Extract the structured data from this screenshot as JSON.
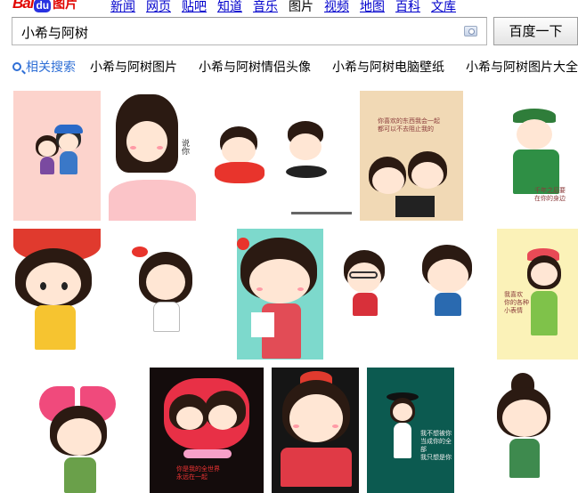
{
  "logo": {
    "bai": "Bai",
    "du": "du",
    "tupian": "图片"
  },
  "nav": [
    "新闻",
    "网页",
    "贴吧",
    "知道",
    "音乐",
    "图片",
    "视频",
    "地图",
    "百科",
    "文库"
  ],
  "search": {
    "query": "小希与阿树",
    "button": "百度一下"
  },
  "related": {
    "heading": "相关搜索",
    "items": [
      "小希与阿树图片",
      "小希与阿树情侣头像",
      "小希与阿树电脑壁纸",
      "小希与阿树图片大全"
    ]
  },
  "colors": {
    "brand_red": "#e10602",
    "brand_blue": "#2932e1",
    "link_blue": "#0000cc",
    "related_blue": "#2f6fd6"
  },
  "results": [
    {
      "label": "cartoon couple pink background"
    },
    {
      "label": "long hair girl with speech text"
    },
    {
      "label": "girl with red bow and boy with mustache"
    },
    {
      "label": "couple with clapperboard and chinese text"
    },
    {
      "label": "boy in green army cap"
    },
    {
      "label": "girl in red hat and yellow shirt"
    },
    {
      "label": "girl with red bow walking"
    },
    {
      "label": "girl in red overalls on mint background"
    },
    {
      "label": "couple glasses girl and boy"
    },
    {
      "label": "girl in pink cap on yellow background"
    },
    {
      "label": "girl with big pink polka dot bow"
    },
    {
      "label": "couple kissing on black background"
    },
    {
      "label": "girl in red hat laughing"
    },
    {
      "label": "girl in black hat on teal background"
    },
    {
      "label": "girl with hair bun in green shirt"
    }
  ]
}
